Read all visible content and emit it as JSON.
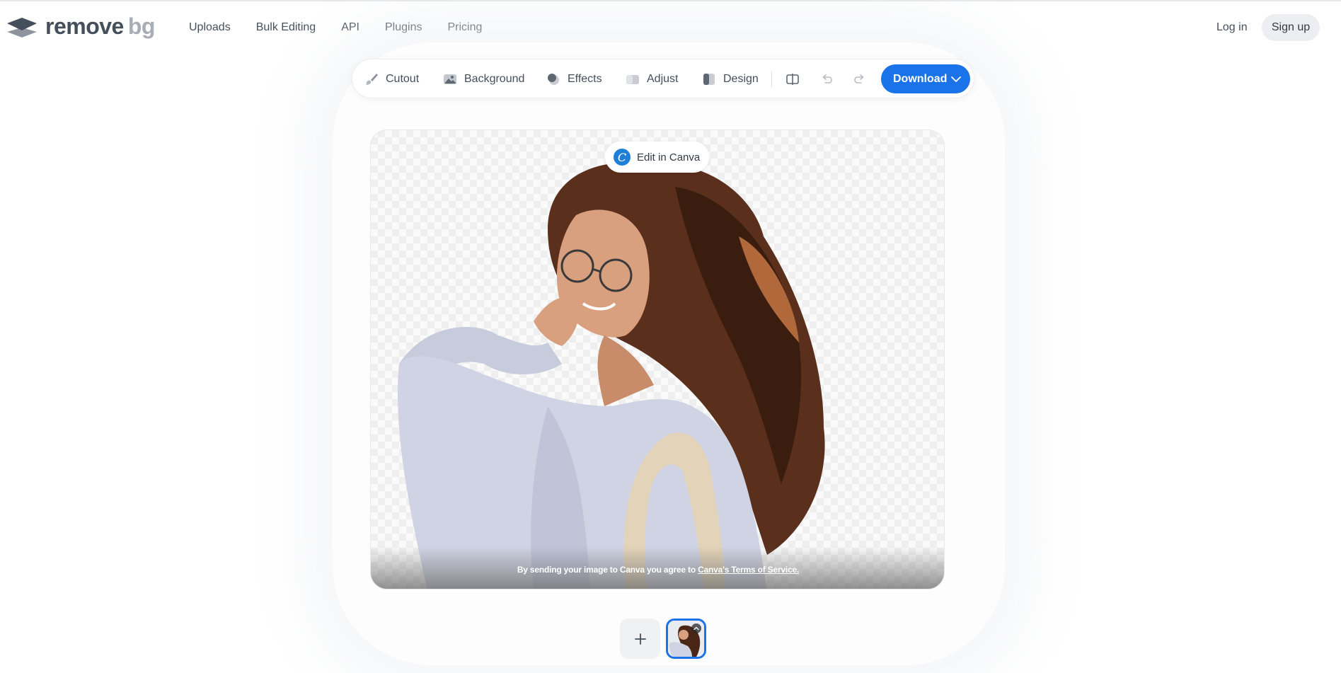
{
  "brand": {
    "word1": "remove",
    "word2": "bg"
  },
  "nav": {
    "items": [
      "Uploads",
      "Bulk Editing",
      "API",
      "Plugins",
      "Pricing"
    ],
    "login": "Log in",
    "signup": "Sign up"
  },
  "toolbar": {
    "tools": [
      {
        "label": "Cutout",
        "icon": "brush-icon"
      },
      {
        "label": "Background",
        "icon": "image-icon"
      },
      {
        "label": "Effects",
        "icon": "effects-icon"
      },
      {
        "label": "Adjust",
        "icon": "adjust-icon"
      },
      {
        "label": "Design",
        "icon": "design-icon"
      }
    ],
    "compare_icon": "compare-icon",
    "undo_icon": "undo-icon",
    "redo_icon": "redo-icon",
    "download_label": "Download"
  },
  "editor": {
    "canva_button": "Edit in Canva",
    "terms_prefix": "By sending your image to Canva you agree to",
    "terms_link": "Canva's Terms of Service."
  },
  "colors": {
    "accent": "#1a73e8",
    "text": "#454f5b",
    "logo_muted": "#a8adb6",
    "pill_bg": "#eceef1"
  }
}
